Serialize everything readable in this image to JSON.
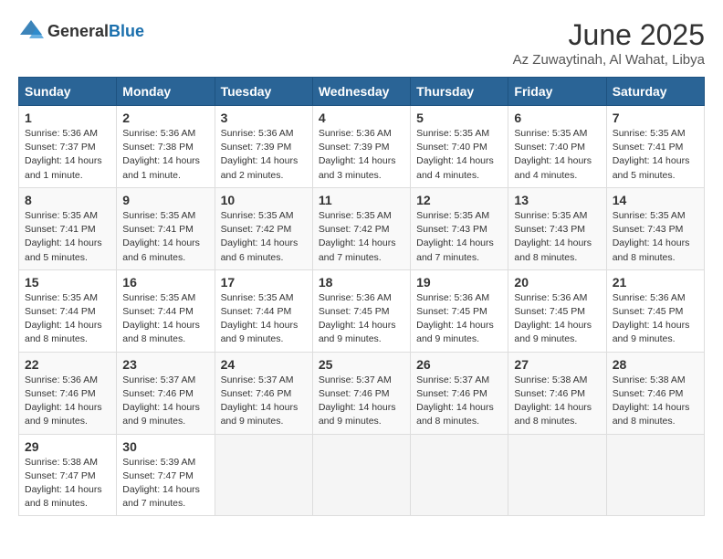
{
  "logo": {
    "general": "General",
    "blue": "Blue"
  },
  "title": "June 2025",
  "subtitle": "Az Zuwaytinah, Al Wahat, Libya",
  "headers": [
    "Sunday",
    "Monday",
    "Tuesday",
    "Wednesday",
    "Thursday",
    "Friday",
    "Saturday"
  ],
  "weeks": [
    [
      {
        "day": "1",
        "sunrise": "5:36 AM",
        "sunset": "7:37 PM",
        "daylight": "14 hours and 1 minute."
      },
      {
        "day": "2",
        "sunrise": "5:36 AM",
        "sunset": "7:38 PM",
        "daylight": "14 hours and 1 minute."
      },
      {
        "day": "3",
        "sunrise": "5:36 AM",
        "sunset": "7:39 PM",
        "daylight": "14 hours and 2 minutes."
      },
      {
        "day": "4",
        "sunrise": "5:36 AM",
        "sunset": "7:39 PM",
        "daylight": "14 hours and 3 minutes."
      },
      {
        "day": "5",
        "sunrise": "5:35 AM",
        "sunset": "7:40 PM",
        "daylight": "14 hours and 4 minutes."
      },
      {
        "day": "6",
        "sunrise": "5:35 AM",
        "sunset": "7:40 PM",
        "daylight": "14 hours and 4 minutes."
      },
      {
        "day": "7",
        "sunrise": "5:35 AM",
        "sunset": "7:41 PM",
        "daylight": "14 hours and 5 minutes."
      }
    ],
    [
      {
        "day": "8",
        "sunrise": "5:35 AM",
        "sunset": "7:41 PM",
        "daylight": "14 hours and 5 minutes."
      },
      {
        "day": "9",
        "sunrise": "5:35 AM",
        "sunset": "7:41 PM",
        "daylight": "14 hours and 6 minutes."
      },
      {
        "day": "10",
        "sunrise": "5:35 AM",
        "sunset": "7:42 PM",
        "daylight": "14 hours and 6 minutes."
      },
      {
        "day": "11",
        "sunrise": "5:35 AM",
        "sunset": "7:42 PM",
        "daylight": "14 hours and 7 minutes."
      },
      {
        "day": "12",
        "sunrise": "5:35 AM",
        "sunset": "7:43 PM",
        "daylight": "14 hours and 7 minutes."
      },
      {
        "day": "13",
        "sunrise": "5:35 AM",
        "sunset": "7:43 PM",
        "daylight": "14 hours and 8 minutes."
      },
      {
        "day": "14",
        "sunrise": "5:35 AM",
        "sunset": "7:43 PM",
        "daylight": "14 hours and 8 minutes."
      }
    ],
    [
      {
        "day": "15",
        "sunrise": "5:35 AM",
        "sunset": "7:44 PM",
        "daylight": "14 hours and 8 minutes."
      },
      {
        "day": "16",
        "sunrise": "5:35 AM",
        "sunset": "7:44 PM",
        "daylight": "14 hours and 8 minutes."
      },
      {
        "day": "17",
        "sunrise": "5:35 AM",
        "sunset": "7:44 PM",
        "daylight": "14 hours and 9 minutes."
      },
      {
        "day": "18",
        "sunrise": "5:36 AM",
        "sunset": "7:45 PM",
        "daylight": "14 hours and 9 minutes."
      },
      {
        "day": "19",
        "sunrise": "5:36 AM",
        "sunset": "7:45 PM",
        "daylight": "14 hours and 9 minutes."
      },
      {
        "day": "20",
        "sunrise": "5:36 AM",
        "sunset": "7:45 PM",
        "daylight": "14 hours and 9 minutes."
      },
      {
        "day": "21",
        "sunrise": "5:36 AM",
        "sunset": "7:45 PM",
        "daylight": "14 hours and 9 minutes."
      }
    ],
    [
      {
        "day": "22",
        "sunrise": "5:36 AM",
        "sunset": "7:46 PM",
        "daylight": "14 hours and 9 minutes."
      },
      {
        "day": "23",
        "sunrise": "5:37 AM",
        "sunset": "7:46 PM",
        "daylight": "14 hours and 9 minutes."
      },
      {
        "day": "24",
        "sunrise": "5:37 AM",
        "sunset": "7:46 PM",
        "daylight": "14 hours and 9 minutes."
      },
      {
        "day": "25",
        "sunrise": "5:37 AM",
        "sunset": "7:46 PM",
        "daylight": "14 hours and 9 minutes."
      },
      {
        "day": "26",
        "sunrise": "5:37 AM",
        "sunset": "7:46 PM",
        "daylight": "14 hours and 8 minutes."
      },
      {
        "day": "27",
        "sunrise": "5:38 AM",
        "sunset": "7:46 PM",
        "daylight": "14 hours and 8 minutes."
      },
      {
        "day": "28",
        "sunrise": "5:38 AM",
        "sunset": "7:46 PM",
        "daylight": "14 hours and 8 minutes."
      }
    ],
    [
      {
        "day": "29",
        "sunrise": "5:38 AM",
        "sunset": "7:47 PM",
        "daylight": "14 hours and 8 minutes."
      },
      {
        "day": "30",
        "sunrise": "5:39 AM",
        "sunset": "7:47 PM",
        "daylight": "14 hours and 7 minutes."
      },
      null,
      null,
      null,
      null,
      null
    ]
  ],
  "labels": {
    "sunrise": "Sunrise:",
    "sunset": "Sunset:",
    "daylight": "Daylight:"
  }
}
